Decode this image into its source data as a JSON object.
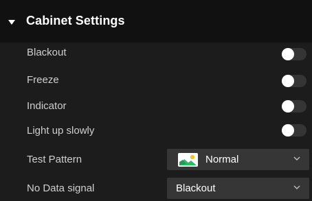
{
  "section": {
    "title": "Cabinet Settings"
  },
  "rows": {
    "blackout": {
      "label": "Blackout",
      "on": false
    },
    "freeze": {
      "label": "Freeze",
      "on": false
    },
    "indicator": {
      "label": "Indicator",
      "on": false
    },
    "light_up_slowly": {
      "label": "Light up slowly",
      "on": false
    },
    "test_pattern": {
      "label": "Test Pattern",
      "value": "Normal",
      "icon": "image-icon"
    },
    "no_data_signal": {
      "label": "No Data signal",
      "value": "Blackout"
    }
  },
  "colors": {
    "background": "#1c1c1c",
    "header": "#111111",
    "toggle_off": "#353535",
    "select_bg": "#363636",
    "icon_green": "#2fb86a",
    "icon_sun": "#f0c43a"
  }
}
